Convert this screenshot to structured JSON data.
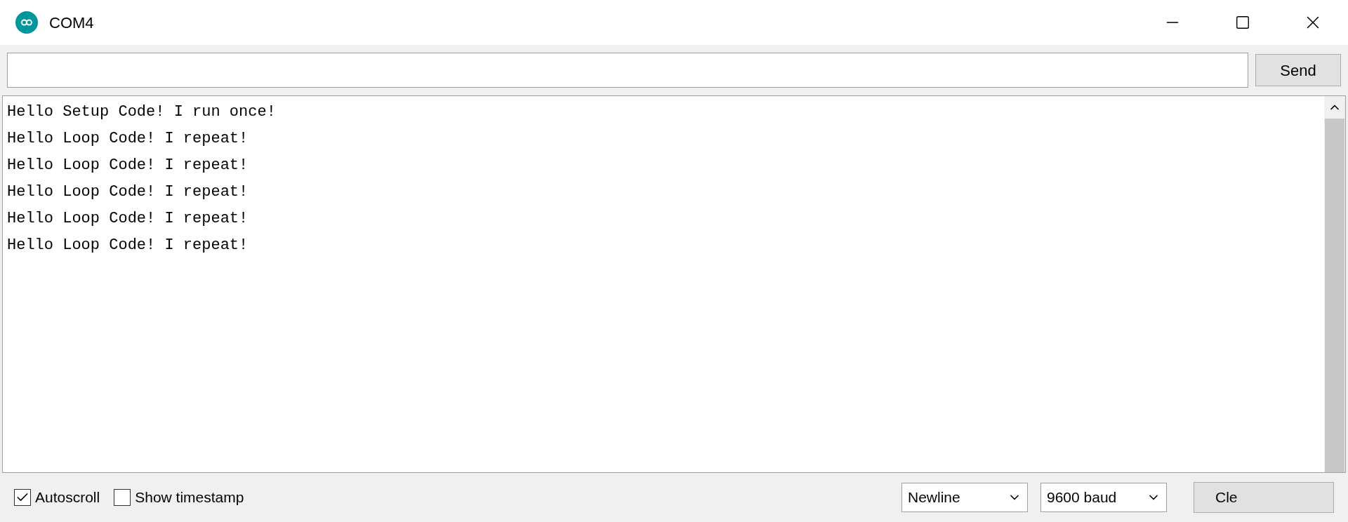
{
  "window": {
    "title": "COM4"
  },
  "send_button": "Send",
  "output_lines": [
    "Hello Setup Code! I run once!",
    "Hello Loop Code! I repeat!",
    "Hello Loop Code! I repeat!",
    "Hello Loop Code! I repeat!",
    "Hello Loop Code! I repeat!",
    "Hello Loop Code! I repeat!"
  ],
  "options": [
    {
      "label": "Autoscroll",
      "checked": true
    },
    {
      "label": "Show timestamp",
      "checked": false
    }
  ],
  "line_ending": "Newline",
  "baud_rate": "9600 baud",
  "clear_button": "Cle"
}
